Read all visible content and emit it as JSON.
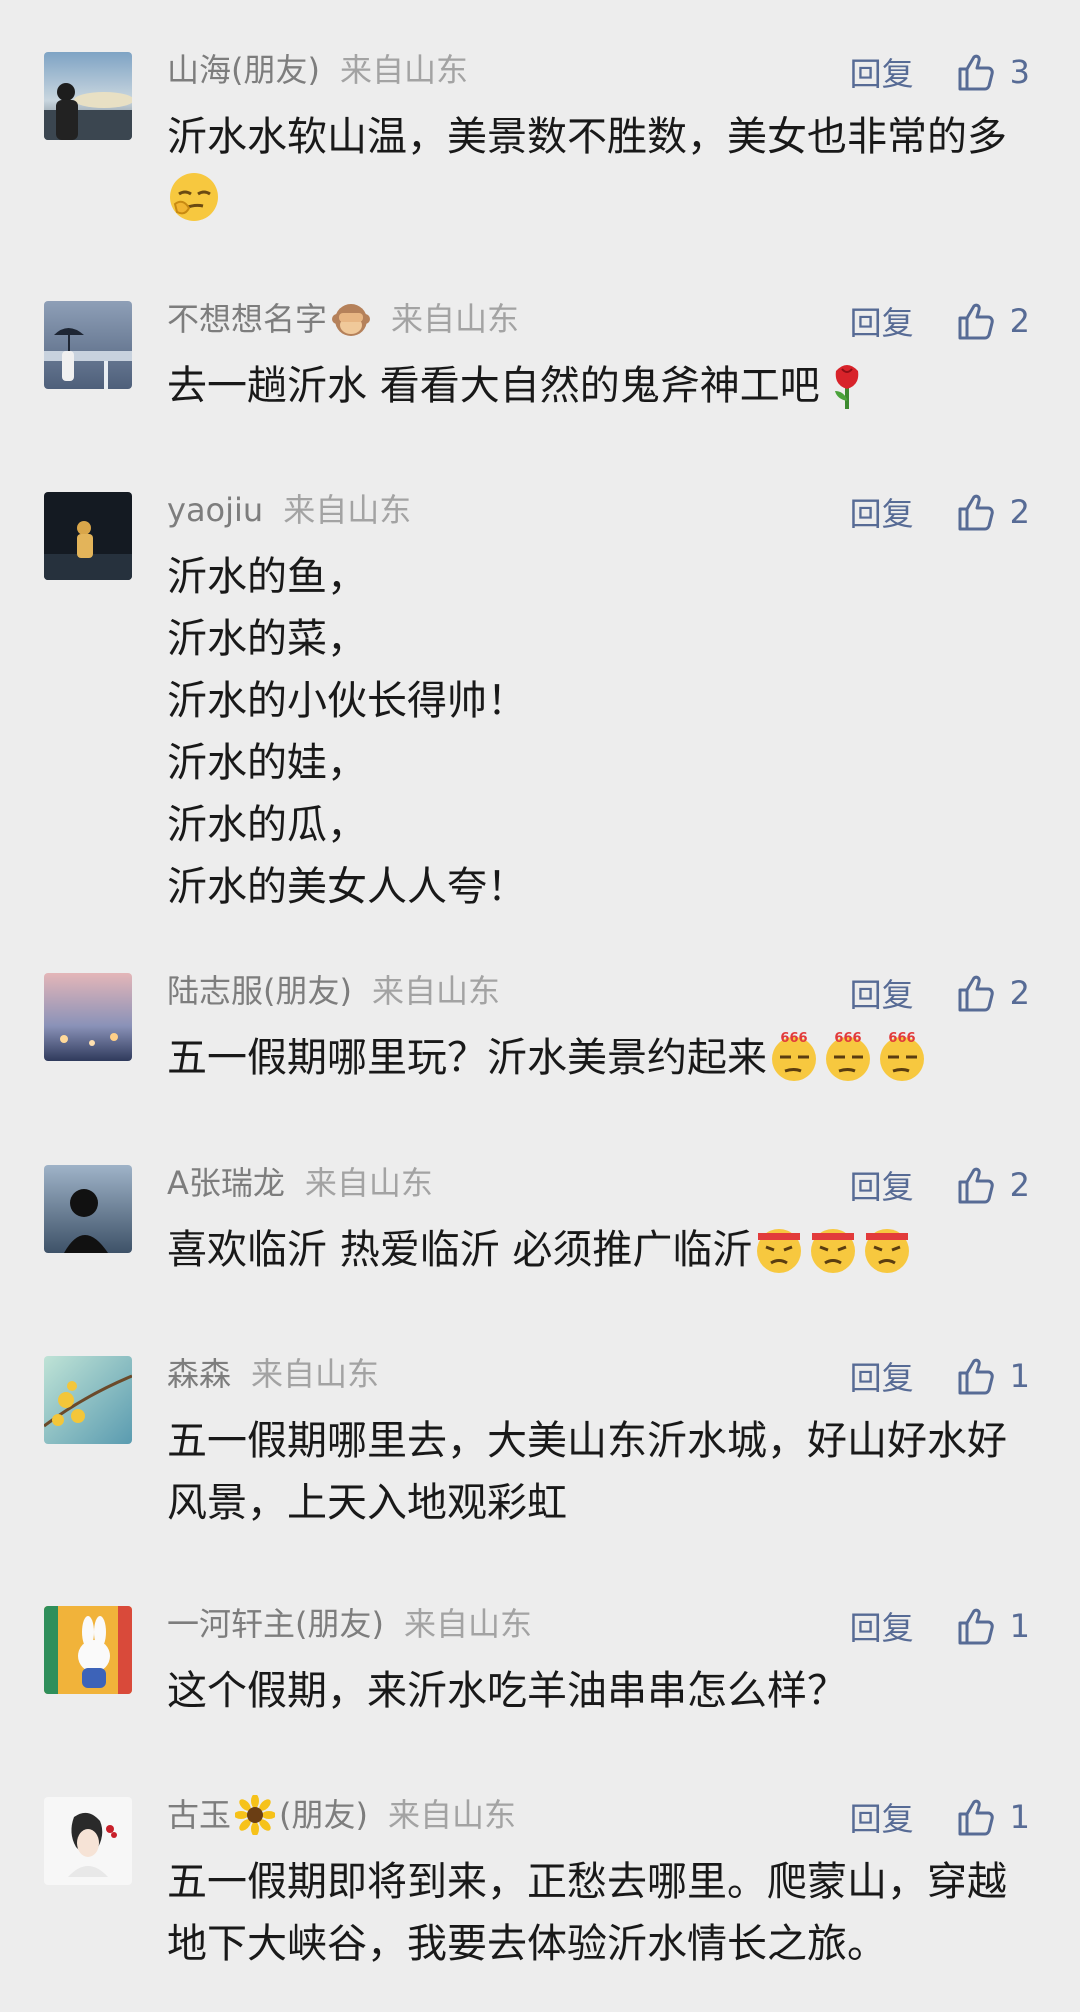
{
  "reply_label": "回复",
  "comments": [
    {
      "name": "山海(朋友)",
      "location": "来自山东",
      "likes": "3",
      "text": "沂水水软山温，美景数不胜数，美女也非常的多",
      "emoji": [
        "smirk-emoji"
      ]
    },
    {
      "name": "不想想名字",
      "name_emoji": "see-no-evil-monkey-emoji",
      "location": "来自山东",
      "likes": "2",
      "text": "去一趟沂水 看看大自然的鬼斧神工吧",
      "emoji": [
        "rose-emoji"
      ]
    },
    {
      "name": "yaojiu",
      "location": "来自山东",
      "likes": "2",
      "text": "沂水的鱼，\n沂水的菜，\n沂水的小伙长得帅！\n沂水的娃，\n沂水的瓜，\n沂水的美女人人夸！",
      "emoji": []
    },
    {
      "name": "陆志服(朋友)",
      "location": "来自山东",
      "likes": "2",
      "text": "五一假期哪里玩？沂水美景约起来",
      "emoji": [
        "666-emoji",
        "666-emoji",
        "666-emoji"
      ],
      "emoji_text": "666"
    },
    {
      "name": "A张瑞龙",
      "location": "来自山东",
      "likes": "2",
      "text": "喜欢临沂 热爱临沂 必须推广临沂",
      "emoji": [
        "fighting-emoji",
        "fighting-emoji",
        "fighting-emoji"
      ]
    },
    {
      "name": "森森",
      "location": "来自山东",
      "likes": "1",
      "text": "五一假期哪里去，大美山东沂水城，好山好水好风景，上天入地观彩虹",
      "emoji": []
    },
    {
      "name": "一河轩主(朋友)",
      "location": "来自山东",
      "likes": "1",
      "text": "这个假期，来沂水吃羊油串串怎么样？",
      "emoji": []
    },
    {
      "name": "古玉",
      "name_emoji": "sunflower-emoji",
      "name_suffix": "(朋友)",
      "location": "来自山东",
      "likes": "1",
      "text": "五一假期即将到来，正愁去哪里。爬蒙山，穿越地下大峡谷，我要去体验沂水情长之旅。",
      "emoji": []
    }
  ]
}
